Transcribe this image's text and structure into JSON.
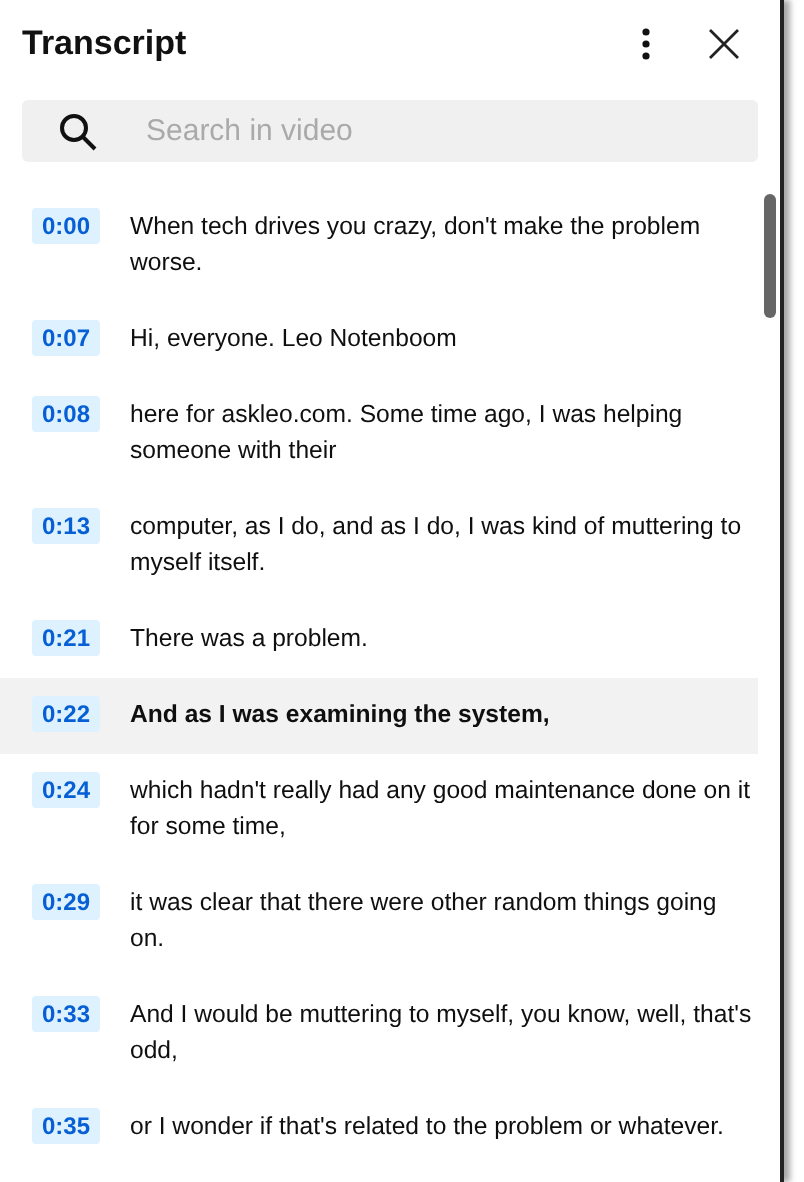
{
  "header": {
    "title": "Transcript"
  },
  "search": {
    "placeholder": "Search in video"
  },
  "segments": [
    {
      "time": "0:00",
      "text": "When tech drives you crazy, don't make the problem worse.",
      "selected": false
    },
    {
      "time": "0:07",
      "text": "Hi, everyone. Leo Notenboom",
      "selected": false
    },
    {
      "time": "0:08",
      "text": "here for askleo.com. Some time ago, I was helping someone with their",
      "selected": false
    },
    {
      "time": "0:13",
      "text": "computer, as I do, and as I do, I was kind of muttering to myself itself.",
      "selected": false
    },
    {
      "time": "0:21",
      "text": "There was a problem.",
      "selected": false
    },
    {
      "time": "0:22",
      "text": "And as I was examining the system,",
      "selected": true
    },
    {
      "time": "0:24",
      "text": "which hadn't really had any good maintenance done on it for some time,",
      "selected": false
    },
    {
      "time": "0:29",
      "text": "it was clear that there were other random things going on.",
      "selected": false
    },
    {
      "time": "0:33",
      "text": "And I would be muttering to myself, you know, well, that's odd,",
      "selected": false
    },
    {
      "time": "0:35",
      "text": "or I wonder if that's related to the problem or whatever.",
      "selected": false
    }
  ]
}
